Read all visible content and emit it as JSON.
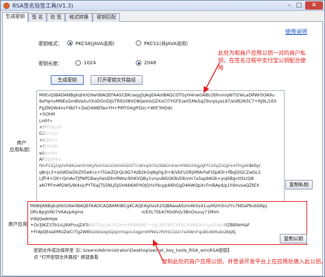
{
  "window": {
    "title": "RSA签名验签工具(V1.3)",
    "controls": {
      "minimize": "–",
      "maximize": "□",
      "close": "✕"
    }
  },
  "tabs": [
    {
      "label": "生成密钥",
      "active": true
    },
    {
      "label": "签 名",
      "active": false
    },
    {
      "label": "验 签",
      "active": false
    },
    {
      "label": "格式转换",
      "active": false
    },
    {
      "label": "密钥匹配",
      "active": false
    }
  ],
  "help_link": "使用说明",
  "key_format": {
    "label": "密钥格式：",
    "options": [
      {
        "label": "PKCS8(JAVA适用)",
        "checked": true
      },
      {
        "label": "PKCS1(非JAVA适用)",
        "checked": false
      }
    ]
  },
  "key_length": {
    "label": "密钥长度：",
    "options": [
      {
        "label": "1024",
        "checked": false
      },
      {
        "label": "2048",
        "checked": true
      }
    ]
  },
  "buttons": {
    "generate": "生成密钥",
    "open_path": "打开密钥文件路径",
    "copy_private": "复制私钥",
    "copy_public": "复制公钥"
  },
  "labels": {
    "private_key": "商户\n应用私钥：",
    "public_key": "商户应用公钥："
  },
  "private_key_text": [
    "MIIEvQIBADANBgkqhkiG9w0BAQEFAASCBKcwggSjAgEAAoIBAQCDTGyH4nwOABLObhvmqW7lzYeLaDRWr0OA9u",
    "9sPqmvMNEsGmBVaXuYXoDOniDjI/TR9208VO8QeVisGZXoCI7YGFEzeit5MeSqZ9vrpLysL87/eVB2N3C7+RJ9L/1Eh",
    "PgZNDW4nvY9bIT+DeD4WBTwnYH+PIRTO4gPiDzc+WtF3HDdc",
    "+0OhM",
    "LHRf+",
    "+0RF8ux9",
    "GZsI+2y",
    "+b3IBn7",
    "+FjTk4Br",
    "wBzm9u",
    "AFOpBPbs",
    "iVvPCEJ2IJeVR8KUwHhIWyNOr0aSO9m60D5fTnWxq9IYb/iBBOi4lwrMN85tAgjdJPfCkfqZhQJFeXPHgWdeSy/",
    "q8njc3+eSWDeDVZ05eKcx+ITUwZQrQL9G74zB2kOqNg0g3I+8/VbFLORjHRArFeFOlp83I+fBqGlQCZwGL5",
    "LJfF4+OX+QmAoTJPWfCBwy0eUDhnRWsr/bhKVQBy1vnyuNGGKBvE8/xm7a5sp9AGb+yoj6BgvtISLtQ8",
    "aN7PFmAfGWS/W4xjcPYT6aJTS5NLJ5JGHAbKAFHOJQYxYbcpp66hGgD46WQpXcFmBAyd/p1h9ovoaQZtEX"
  ],
  "public_key_text": [
    "MIIBIjANBgkqhkiG9w0BAQEFAAOCAQ8AMIIBCgKCAQEAg0xsh2OJ8AwaASzm4b5s41uyM2H3in2Yv7NDaPbvbD6pj",
    "DRL8pgVW/7V6Azp4gmx                                           n/EXL7SkA7Klo9Vjv3BoOsuuy71MVn",
    "VdqQwAHqw",
    "+OcljWZ37b1rLj9XPvujZ4TetNIT2yjvM72QmmMNNd967+tgC56T9FCXFbCHWBUbcnyuOq6nRZBBYeHIaF",
    "+FI4pQEea0MUZwCrTg2W8SUibGoqSQojmYupiv3xJpmMPAIs7RH5CGUr7eXWnFquBlvBMubrzkqXj"
  ],
  "status_lines": [
    "密钥文件成功保存至【C:\\Users\\Administrator\\Desktop\\secret_key_tools_RSA_win\\RSA密钥】",
    "点 \"打开密钥文件路径\" 按钮查看"
  ],
  "annotations": {
    "private_note": [
      "此处为和商户应用公钥一对的商户私",
      "钥，在签名过程中支付宝公钥配合使",
      "用"
    ],
    "public_note": "复制此处的商户应用公钥，并登录开发平台上在应用处填入此公钥。"
  },
  "colors": {
    "annotation": "#e11b1b",
    "link": "#1e50c8",
    "title_bar": "#cfdcf2"
  }
}
